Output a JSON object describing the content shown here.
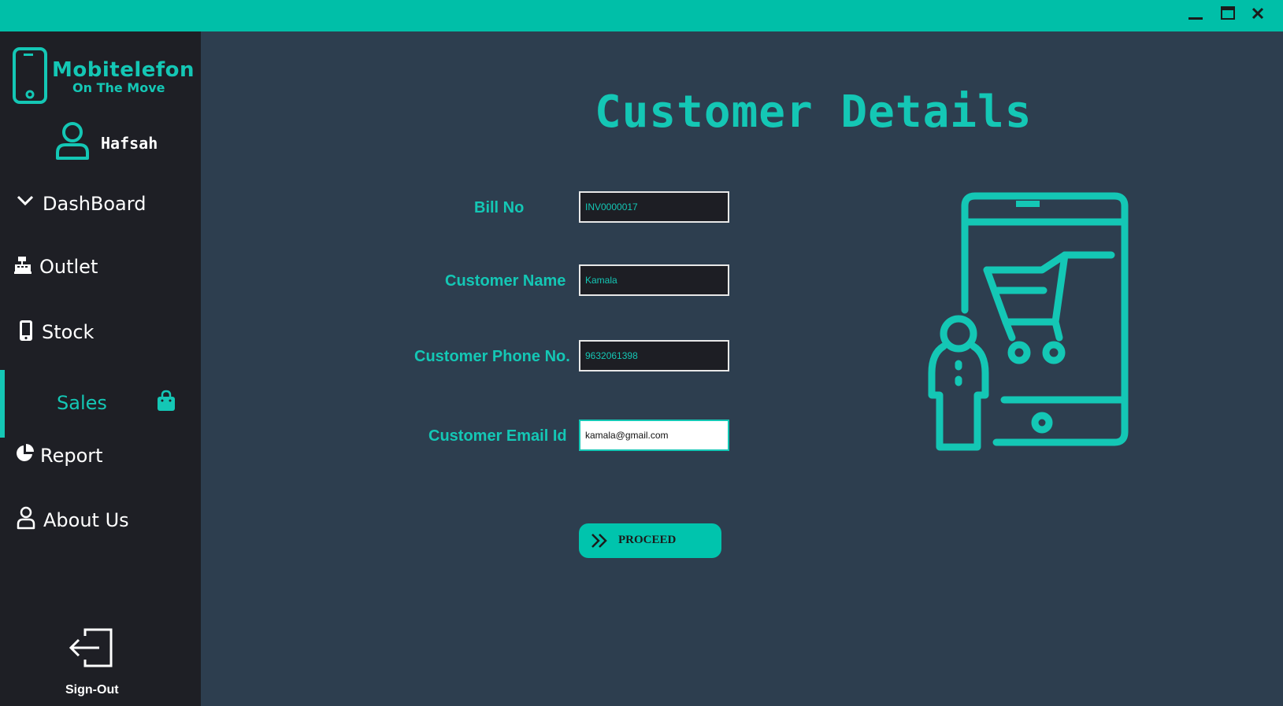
{
  "window": {
    "controls": {
      "minimize": "minimize-icon",
      "maximize": "maximize-icon",
      "close": "close-icon"
    }
  },
  "colors": {
    "accent": "#14c7b5",
    "titlebar": "#00bfa8",
    "sidebar": "#1e1f25",
    "main": "#2d3e4f"
  },
  "brand": {
    "name": "Mobitelefon",
    "tagline": "On The Move",
    "icon": "phone-icon"
  },
  "user": {
    "name": "Hafsah",
    "icon": "user-icon"
  },
  "sidebar": {
    "items": [
      {
        "label": "DashBoard",
        "icon": "chevron-down-icon"
      },
      {
        "label": "Outlet",
        "icon": "cash-register-icon"
      },
      {
        "label": "Stock",
        "icon": "mobile-icon"
      },
      {
        "label": "Sales",
        "icon": "shopping-bag-icon",
        "active": true
      },
      {
        "label": "Report",
        "icon": "pie-chart-icon"
      },
      {
        "label": "About Us",
        "icon": "user-icon"
      }
    ],
    "signout": {
      "label": "Sign-Out",
      "icon": "sign-out-icon"
    }
  },
  "main": {
    "title": "Customer Details",
    "fields": [
      {
        "label": "Bill No",
        "value": "INV0000017"
      },
      {
        "label": "Customer Name",
        "value": "Kamala"
      },
      {
        "label": "Customer Phone No.",
        "value": "9632061398"
      },
      {
        "label": "Customer Email Id",
        "value": "kamala@gmail.com"
      }
    ],
    "proceed_label": "PROCEED",
    "illustration": "mobile-shopping-illustration"
  }
}
